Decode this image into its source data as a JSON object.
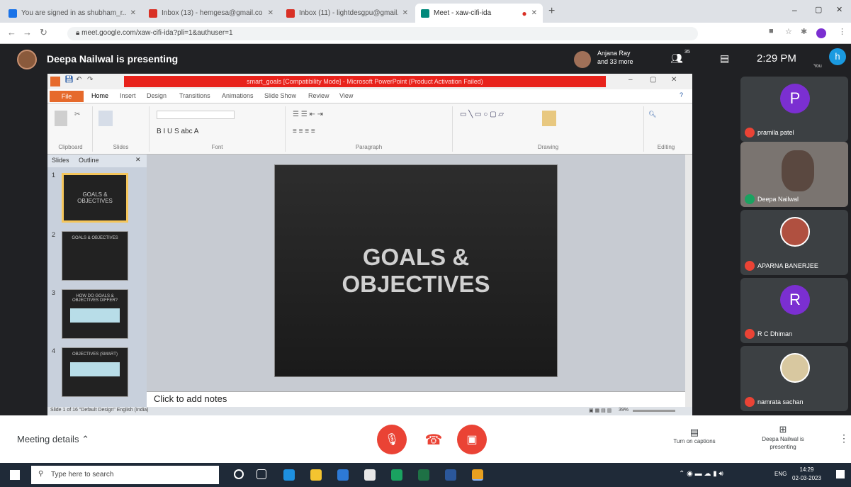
{
  "browser": {
    "tabs": [
      {
        "label": "You are signed in as shubham_r...",
        "active": false,
        "favicon_color": "#1a73e8"
      },
      {
        "label": "Inbox (13) - hemgesa@gmail.co",
        "active": false,
        "favicon_color": "#d93025"
      },
      {
        "label": "Inbox (11) - lightdesgpu@gmail...",
        "active": false,
        "favicon_color": "#d93025"
      },
      {
        "label": "Meet - xaw-cifi-ida",
        "active": true,
        "favicon_color": "#00897b"
      }
    ],
    "url": "meet.google.com/xaw-cifi-ida?pli=1&authuser=1"
  },
  "meet": {
    "presenter_banner": "Deepa Nailwal is presenting",
    "joined_name": "Anjana Ray",
    "joined_more": "and 33 more",
    "participants_count": "35",
    "time": "2:29 PM",
    "you_label": "You",
    "self_initial": "h",
    "participants": [
      {
        "name": "pramila patel",
        "initial": "P",
        "color": "#7b2fd1"
      },
      {
        "name": "Deepa Nailwal",
        "initial": "",
        "color": "#6b6b6b"
      },
      {
        "name": "APARNA BANERJEE",
        "initial": "",
        "color": "#b05040"
      },
      {
        "name": "R C Dhiman",
        "initial": "R",
        "color": "#7b2fd1"
      },
      {
        "name": "namrata sachan",
        "initial": "",
        "color": "#d8c8a0"
      }
    ],
    "meeting_details": "Meeting details",
    "captions_label": "Turn on captions",
    "presenting_label": "Deepa Nailwal is presenting"
  },
  "powerpoint": {
    "title": "smart_goals [Compatibility Mode] - Microsoft PowerPoint (Product Activation Failed)",
    "ribbon_tabs": [
      "File",
      "Home",
      "Insert",
      "Design",
      "Transitions",
      "Animations",
      "Slide Show",
      "Review",
      "View"
    ],
    "groups": [
      "Clipboard",
      "Slides",
      "Font",
      "Paragraph",
      "Drawing",
      "Editing"
    ],
    "panel_tabs": [
      "Slides",
      "Outline"
    ],
    "thumbnails": [
      {
        "num": "1",
        "text": "GOALS & OBJECTIVES"
      },
      {
        "num": "2",
        "text": "GOALS & OBJECTIVES"
      },
      {
        "num": "3",
        "text": "HOW DO GOALS & OBJECTIVES DIFFER?"
      },
      {
        "num": "4",
        "text": "OBJECTIVES (SMART)"
      }
    ],
    "slide_title": "GOALS & OBJECTIVES",
    "notes_placeholder": "Click to add notes",
    "status_left": "Slide 1 of 16   \"Default Design\"   English (India)",
    "zoom": "39%"
  },
  "taskbar": {
    "search_placeholder": "Type here to search",
    "time": "14:29",
    "date": "02-03-2023",
    "lang": "ENG"
  }
}
